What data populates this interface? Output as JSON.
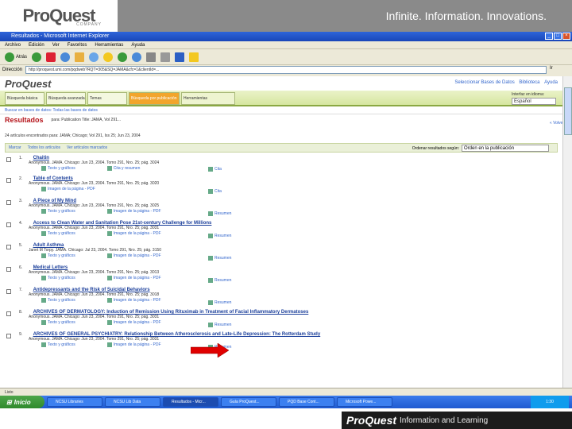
{
  "slide": {
    "logo_text": "ProQuest",
    "logo_sub": "COMPANY",
    "tagline": "Infinite. Information. Innovations."
  },
  "ie": {
    "title": "Resultados - Microsoft Internet Explorer",
    "menu": [
      "Archivo",
      "Edición",
      "Ver",
      "Favoritos",
      "Herramientas",
      "Ayuda"
    ],
    "toolbar": [
      "Atrás"
    ],
    "address_label": "Dirección",
    "address_value": "http://proquest.umi.com/pqdweb?RQT=305&SQ=JAMA&cfc=1&clientId=...",
    "go_label": "Ir",
    "status_text": "Listo"
  },
  "pq": {
    "logo": "ProQuest",
    "top_links": [
      "Seleccionar Bases de Datos",
      "Biblioteca",
      "Ayuda"
    ],
    "tabs": [
      "Búsqueda básica",
      "Búsqueda avanzada",
      "Temas",
      "Búsqueda por publicación",
      "Herramientas"
    ],
    "lang_label": "Interfaz en idioma:",
    "lang_value": "Español",
    "crumb": "Buscar en bases de datos: Todas las bases de datos",
    "results_title": "Resultados",
    "results_meta": "para: Publication Title: JAMA, Vol 291...",
    "results_right": "« Volver",
    "count_line": "24 artículos encontrados para: JAMA; Chicago; Vol 291, Iss 25; Jun 23, 2004",
    "action_links": [
      "Marcar",
      "Todos los artículos",
      "Ver artículos marcados"
    ],
    "sort_label": "Ordenar resultados según:",
    "sort_value": "Orden en la publicación"
  },
  "results": [
    {
      "num": "1.",
      "title": "Chaitin",
      "cite": "Anonymous. JAMA. Chicago: Jun 23, 2004. Tomo 291, Nro. 25; pág. 3024",
      "formats": [
        "Texto y gráficos",
        "Cita y resumen"
      ],
      "side": "Cita"
    },
    {
      "num": "2.",
      "title": "Table of Contents",
      "cite": "Anonymous. JAMA. Chicago: Jun 23, 2004. Tomo 291, Nro. 25; pág. 3020",
      "formats": [
        "Imagen de la página - PDF"
      ],
      "side": "Cita"
    },
    {
      "num": "3.",
      "title": "A Piece of My Mind",
      "cite": "Anonymous. JAMA. Chicago: Jun 23, 2004. Tomo 291, Nro. 25; pág. 3025",
      "formats": [
        "Texto y gráficos",
        "Imagen de la página - PDF"
      ],
      "side": "Resumen"
    },
    {
      "num": "4.",
      "title": "Access to Clean Water and Sanitation Pose 21st-century Challenge for Millions",
      "cite": "Anonymous. JAMA. Chicago: Jun 23, 2004. Tomo 291, Nro. 25; pág. 3031",
      "formats": [
        "Texto y gráficos",
        "Imagen de la página - PDF"
      ],
      "side": "Resumen"
    },
    {
      "num": "5.",
      "title": "Adult Asthma",
      "cite": "Janet M Torpy. JAMA. Chicago: Jul 23, 2004. Tomo 291, Nro. 25; pág. 3150",
      "formats": [
        "Texto y gráficos",
        "Imagen de la página - PDF"
      ],
      "side": "Resumen"
    },
    {
      "num": "6.",
      "title": "Medical Letters",
      "cite": "Anonymous. JAMA. Chicago: Jun 23, 2004. Tomo 291, Nro. 25; pág. 3013",
      "formats": [
        "Texto y gráficos",
        "Imagen de la página - PDF"
      ],
      "side": "Resumen"
    },
    {
      "num": "7.",
      "title": "Antidepressants and the Risk of Suicidal Behaviors",
      "cite": "Anonymous. JAMA. Chicago: Jun 23, 2004. Tomo 291, Nro. 25; pág. 3018",
      "formats": [
        "Texto y gráficos",
        "Imagen de la página - PDF"
      ],
      "side": "Resumen"
    },
    {
      "num": "8.",
      "title": "ARCHIVES OF DERMATOLOGY: Induction of Remission Using Rituximab in Treatment of Facial Inflammatory Dermatoses",
      "cite": "Anonymous. JAMA. Chicago: Jun 23, 2004. Tomo 291, Nro. 25; pág. 3031",
      "formats": [
        "Texto y gráficos",
        "Imagen de la página - PDF"
      ],
      "side": "Resumen"
    },
    {
      "num": "9.",
      "title": "ARCHIVES OF GENERAL PSYCHIATRY: Relationship Between Atherosclerosis and Late-Life Depression: The Rotterdam Study",
      "cite": "Anonymous. JAMA. Chicago: Jun 23, 2004. Tomo 291, Nro. 25; pág. 3031",
      "formats": [
        "Texto y gráficos",
        "Imagen de la página - PDF"
      ],
      "side": "Resumen"
    }
  ],
  "taskbar": {
    "start": "Inicio",
    "tasks": [
      "NCSU Libraries",
      "NCSU Lib Data",
      "Resultados - Micr...",
      "Guía ProQuest...",
      "PQD Base Cont...",
      "Microsoft Powe..."
    ],
    "tray": "1:30"
  },
  "footer": {
    "logo": "ProQuest",
    "tag": "Information and Learning"
  },
  "colors": {
    "results_title": "#b5141b",
    "active_tab": "#f2a52c",
    "tab_bar": "#d6e6a0",
    "arrow": "#e00000",
    "taskbar": "#1f5ad0"
  }
}
